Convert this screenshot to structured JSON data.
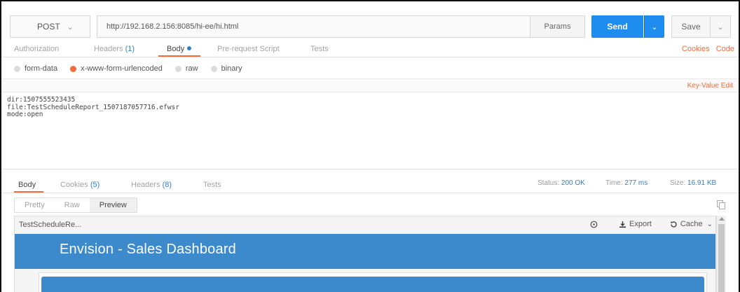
{
  "request": {
    "method": "POST",
    "url": "http://192.168.2.156:8085/hi-ee/hi.html",
    "params_label": "Params",
    "send_label": "Send",
    "save_label": "Save"
  },
  "request_tabs": {
    "authorization": "Authorization",
    "headers": "Headers",
    "headers_count": "(1)",
    "body": "Body",
    "prerequest": "Pre-request Script",
    "tests": "Tests",
    "cookies": "Cookies",
    "code": "Code"
  },
  "body_types": {
    "form_data": "form-data",
    "urlencoded": "x-www-form-urlencoded",
    "raw": "raw",
    "binary": "binary"
  },
  "editor": {
    "kv_label": "Key-Value Edit",
    "lines": [
      "dir:1507555523435",
      "file:TestScheduleReport_1507187057716.efwsr",
      "mode:open"
    ]
  },
  "response_tabs": {
    "body": "Body",
    "cookies": "Cookies",
    "cookies_count": "(5)",
    "headers": "Headers",
    "headers_count": "(8)",
    "tests": "Tests"
  },
  "response_meta": {
    "status_label": "Status:",
    "status_value": "200 OK",
    "time_label": "Time:",
    "time_value": "277 ms",
    "size_label": "Size:",
    "size_value": "16.91 KB"
  },
  "view_modes": {
    "pretty": "Pretty",
    "raw": "Raw",
    "preview": "Preview"
  },
  "preview": {
    "tab_title": "TestScheduleRe...",
    "export_label": "Export",
    "cache_label": "Cache",
    "banner_title": "Envision - Sales Dashboard"
  },
  "colors": {
    "accent_orange": "#f26b3a",
    "send_blue": "#1f8cf0",
    "banner_blue": "#3c89cc",
    "link_blue": "#2f7fd1"
  }
}
